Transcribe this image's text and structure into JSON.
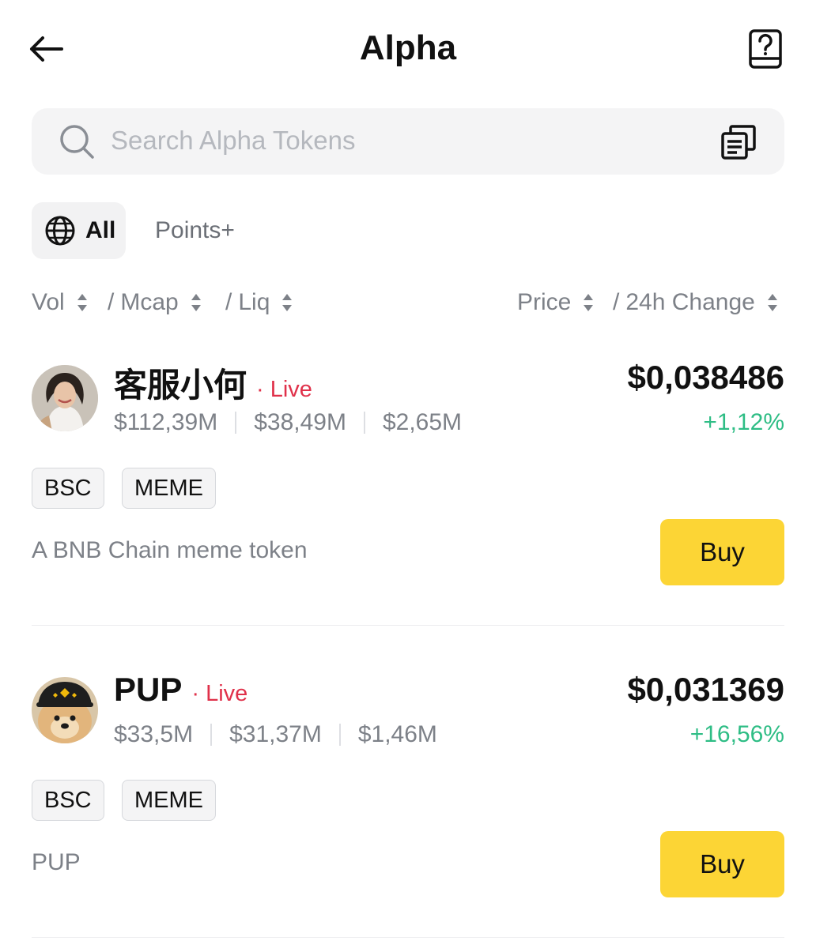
{
  "header": {
    "title": "Alpha",
    "back_icon": "arrow-left-icon",
    "help_icon": "question-book-icon"
  },
  "search": {
    "placeholder": "Search Alpha Tokens",
    "value": "",
    "watchlist_icon": "list-copy-icon"
  },
  "tabs": [
    {
      "label": "All",
      "icon": "globe-icon",
      "selected": true
    },
    {
      "label": "Points+",
      "selected": false
    }
  ],
  "sort_columns": {
    "vol": "Vol",
    "mcap": "Mcap",
    "liq": "Liq",
    "price": "Price",
    "change": "24h Change"
  },
  "tokens": [
    {
      "name": "客服小何",
      "status": "· Live",
      "volume": "$112,39M",
      "mcap": "$38,49M",
      "liquidity": "$2,65M",
      "price": "$0,038486",
      "change": "+1,12%",
      "tags": [
        "BSC",
        "MEME"
      ],
      "description": "A BNB Chain meme token",
      "buy_label": "Buy"
    },
    {
      "name": "PUP",
      "status": "· Live",
      "volume": "$33,5M",
      "mcap": "$31,37M",
      "liquidity": "$1,46M",
      "price": "$0,031369",
      "change": "+16,56%",
      "tags": [
        "BSC",
        "MEME"
      ],
      "description": "PUP",
      "buy_label": "Buy"
    }
  ],
  "colors": {
    "accent_yellow": "#fcd535",
    "live_red": "#e0314a",
    "positive_green": "#2ebd85",
    "muted_text": "#7d8188"
  }
}
